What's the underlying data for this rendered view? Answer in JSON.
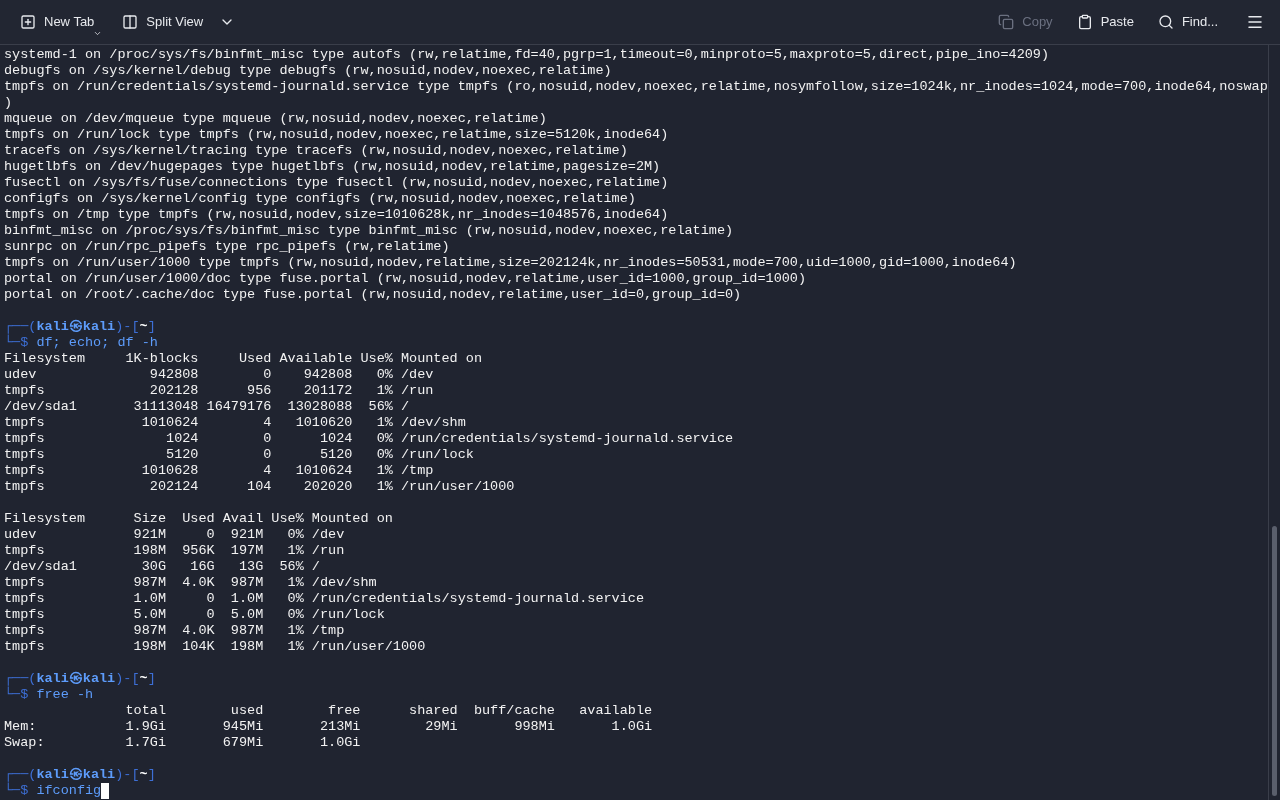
{
  "toolbar": {
    "left": [
      {
        "kind": "new-tab",
        "label": "New Tab",
        "disabled": false
      },
      {
        "kind": "split-view",
        "label": "Split View",
        "disabled": false
      }
    ],
    "right": [
      {
        "kind": "copy",
        "label": "Copy",
        "disabled": true
      },
      {
        "kind": "paste",
        "label": "Paste",
        "disabled": false
      },
      {
        "kind": "find",
        "label": "Find...",
        "disabled": false
      }
    ]
  },
  "lines": [
    {
      "kind": "text",
      "text": "systemd-1 on /proc/sys/fs/binfmt_misc type autofs (rw,relatime,fd=40,pgrp=1,timeout=0,minproto=5,maxproto=5,direct,pipe_ino=4209)"
    },
    {
      "kind": "text",
      "text": "debugfs on /sys/kernel/debug type debugfs (rw,nosuid,nodev,noexec,relatime)"
    },
    {
      "kind": "text",
      "text": "tmpfs on /run/credentials/systemd-journald.service type tmpfs (ro,nosuid,nodev,noexec,relatime,nosymfollow,size=1024k,nr_inodes=1024,mode=700,inode64,noswap"
    },
    {
      "kind": "text",
      "text": ")"
    },
    {
      "kind": "text",
      "text": "mqueue on /dev/mqueue type mqueue (rw,nosuid,nodev,noexec,relatime)"
    },
    {
      "kind": "text",
      "text": "tmpfs on /run/lock type tmpfs (rw,nosuid,nodev,noexec,relatime,size=5120k,inode64)"
    },
    {
      "kind": "text",
      "text": "tracefs on /sys/kernel/tracing type tracefs (rw,nosuid,nodev,noexec,relatime)"
    },
    {
      "kind": "text",
      "text": "hugetlbfs on /dev/hugepages type hugetlbfs (rw,nosuid,nodev,relatime,pagesize=2M)"
    },
    {
      "kind": "text",
      "text": "fusectl on /sys/fs/fuse/connections type fusectl (rw,nosuid,nodev,noexec,relatime)"
    },
    {
      "kind": "text",
      "text": "configfs on /sys/kernel/config type configfs (rw,nosuid,nodev,noexec,relatime)"
    },
    {
      "kind": "text",
      "text": "tmpfs on /tmp type tmpfs (rw,nosuid,nodev,size=1010628k,nr_inodes=1048576,inode64)"
    },
    {
      "kind": "text",
      "text": "binfmt_misc on /proc/sys/fs/binfmt_misc type binfmt_misc (rw,nosuid,nodev,noexec,relatime)"
    },
    {
      "kind": "text",
      "text": "sunrpc on /run/rpc_pipefs type rpc_pipefs (rw,relatime)"
    },
    {
      "kind": "text",
      "text": "tmpfs on /run/user/1000 type tmpfs (rw,nosuid,nodev,relatime,size=202124k,nr_inodes=50531,mode=700,uid=1000,gid=1000,inode64)"
    },
    {
      "kind": "text",
      "text": "portal on /run/user/1000/doc type fuse.portal (rw,nosuid,nodev,relatime,user_id=1000,group_id=1000)"
    },
    {
      "kind": "text",
      "text": "portal on /root/.cache/doc type fuse.portal (rw,nosuid,nodev,relatime,user_id=0,group_id=0)"
    },
    {
      "kind": "blank"
    },
    {
      "kind": "prompt",
      "open": "┌──(",
      "user": "kali",
      "at": "㉿",
      "host": "kali",
      "mid": ")-[",
      "dir": "~",
      "close": "]",
      "lead": "└─$",
      "command": "df; echo; df -h",
      "cursor": false
    },
    {
      "kind": "text",
      "text": "Filesystem     1K-blocks     Used Available Use% Mounted on"
    },
    {
      "kind": "text",
      "text": "udev              942808        0    942808   0% /dev"
    },
    {
      "kind": "text",
      "text": "tmpfs             202128      956    201172   1% /run"
    },
    {
      "kind": "text",
      "text": "/dev/sda1       31113048 16479176  13028088  56% /"
    },
    {
      "kind": "text",
      "text": "tmpfs            1010624        4   1010620   1% /dev/shm"
    },
    {
      "kind": "text",
      "text": "tmpfs               1024        0      1024   0% /run/credentials/systemd-journald.service"
    },
    {
      "kind": "text",
      "text": "tmpfs               5120        0      5120   0% /run/lock"
    },
    {
      "kind": "text",
      "text": "tmpfs            1010628        4   1010624   1% /tmp"
    },
    {
      "kind": "text",
      "text": "tmpfs             202124      104    202020   1% /run/user/1000"
    },
    {
      "kind": "blank"
    },
    {
      "kind": "text",
      "text": "Filesystem      Size  Used Avail Use% Mounted on"
    },
    {
      "kind": "text",
      "text": "udev            921M     0  921M   0% /dev"
    },
    {
      "kind": "text",
      "text": "tmpfs           198M  956K  197M   1% /run"
    },
    {
      "kind": "text",
      "text": "/dev/sda1        30G   16G   13G  56% /"
    },
    {
      "kind": "text",
      "text": "tmpfs           987M  4.0K  987M   1% /dev/shm"
    },
    {
      "kind": "text",
      "text": "tmpfs           1.0M     0  1.0M   0% /run/credentials/systemd-journald.service"
    },
    {
      "kind": "text",
      "text": "tmpfs           5.0M     0  5.0M   0% /run/lock"
    },
    {
      "kind": "text",
      "text": "tmpfs           987M  4.0K  987M   1% /tmp"
    },
    {
      "kind": "text",
      "text": "tmpfs           198M  104K  198M   1% /run/user/1000"
    },
    {
      "kind": "blank"
    },
    {
      "kind": "prompt",
      "open": "┌──(",
      "user": "kali",
      "at": "㉿",
      "host": "kali",
      "mid": ")-[",
      "dir": "~",
      "close": "]",
      "lead": "└─$",
      "command": "free -h",
      "cursor": false
    },
    {
      "kind": "text",
      "text": "               total        used        free      shared  buff/cache   available"
    },
    {
      "kind": "text",
      "text": "Mem:           1.9Gi       945Mi       213Mi        29Mi       998Mi       1.0Gi"
    },
    {
      "kind": "text",
      "text": "Swap:          1.7Gi       679Mi       1.0Gi"
    },
    {
      "kind": "blank"
    },
    {
      "kind": "prompt",
      "open": "┌──(",
      "user": "kali",
      "at": "㉿",
      "host": "kali",
      "mid": ")-[",
      "dir": "~",
      "close": "]",
      "lead": "└─$",
      "command": "ifconfig",
      "cursor": true
    }
  ]
}
